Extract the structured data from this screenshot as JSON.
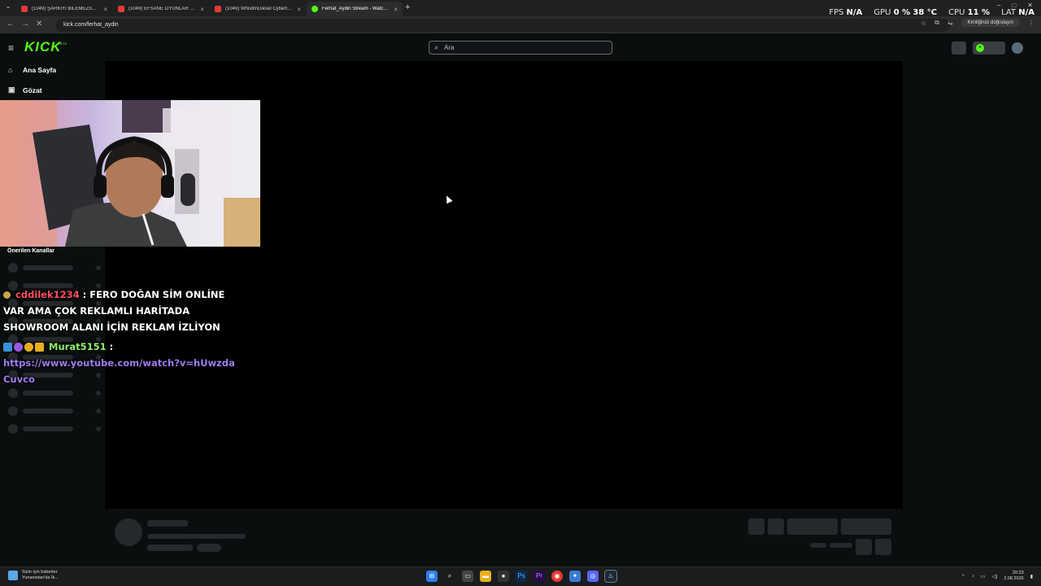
{
  "browser": {
    "tabs": [
      {
        "title": "(1049) ŞARKIYI BİLEMEZSEN DE",
        "icon": "youtube-icon"
      },
      {
        "title": "(1049) EFSANE OYUNLAR SERİ",
        "icon": "youtube-icon"
      },
      {
        "title": "(1049) WhistlinDiesel Cybertruc",
        "icon": "youtube-icon"
      },
      {
        "title": "Ferhat_Aydin Stream - Watch L",
        "icon": "kick-icon"
      }
    ],
    "url": "kick.com/ferhat_aydin",
    "profile_label": "Kimliğinizi doğrulayın"
  },
  "stats_overlay": {
    "fps_label": "FPS",
    "fps_value": "N/A",
    "gpu_label": "GPU",
    "gpu_value": "0 %",
    "gpu_temp": "38 °C",
    "cpu_label": "CPU",
    "cpu_value": "11 %",
    "lat_label": "LAT",
    "lat_value": "N/A"
  },
  "header": {
    "logo": "KICK",
    "logo_badge": "BETA",
    "search_placeholder": "Ara"
  },
  "sidebar": {
    "items": [
      {
        "label": "Ana Sayfa",
        "icon": "home-icon"
      },
      {
        "label": "Gözat",
        "icon": "browse-icon"
      }
    ],
    "recommended_title": "Önerilen Kanallar"
  },
  "chat": {
    "messages": [
      {
        "user": "cddilek1234",
        "text": "FERO DOĞAN SİM ONLİNE VAR AMA ÇOK REKLAMLI HARİTADA SHOWROOM ALANI İÇİN REKLAM İZLİYON",
        "user_color": "#ff4d5e"
      },
      {
        "user": "Murat5151",
        "text": "https://www.youtube.com/watch?v=hUwzdaCuvco",
        "user_color": "#8ff06a"
      }
    ],
    "separator": ":"
  },
  "taskbar": {
    "news_title": "Sizin için haberler",
    "news_subtitle": "Yunanistan'da İk...",
    "time": "20:23",
    "date": "2.08.2026"
  },
  "colors": {
    "kick_green": "#53fc18",
    "page_bg": "#0b0e0f",
    "video_bg": "#000000"
  }
}
